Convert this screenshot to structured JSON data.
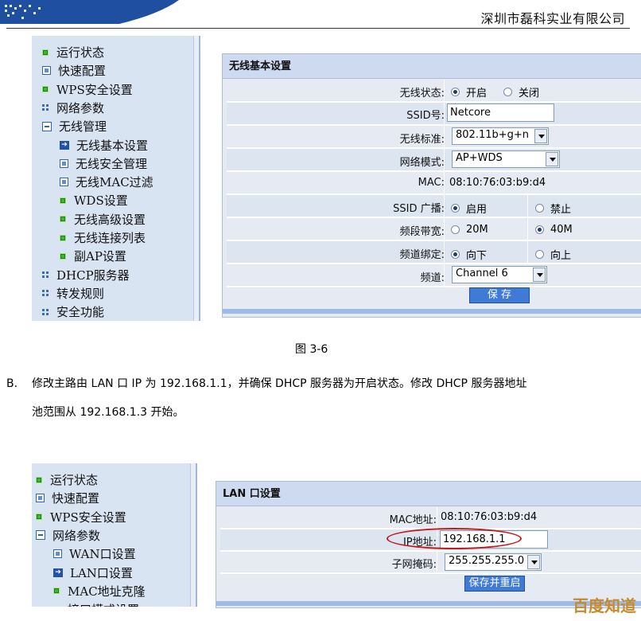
{
  "header": {
    "company": "深圳市磊科实业有限公司"
  },
  "figure1": {
    "caption": "图  3-6",
    "sidebar": {
      "items": [
        {
          "label": "运行状态",
          "icon": "bullet-green-icon",
          "indent": 0
        },
        {
          "label": "快速配置",
          "icon": "box-icon",
          "indent": 0
        },
        {
          "label": "WPS安全设置",
          "icon": "bullet-green-icon",
          "indent": 0
        },
        {
          "label": "网络参数",
          "icon": "grid-icon",
          "indent": 0
        },
        {
          "label": "无线管理",
          "icon": "minus-box-icon",
          "indent": 0
        },
        {
          "label": "无线基本设置",
          "icon": "arrow-right-icon",
          "indent": 1
        },
        {
          "label": "无线安全管理",
          "icon": "box-icon",
          "indent": 1
        },
        {
          "label": "无线MAC过滤",
          "icon": "box-icon",
          "indent": 1
        },
        {
          "label": "WDS设置",
          "icon": "bullet-green-icon",
          "indent": 1
        },
        {
          "label": "无线高级设置",
          "icon": "bullet-green-icon",
          "indent": 1
        },
        {
          "label": "无线连接列表",
          "icon": "bullet-green-icon",
          "indent": 1
        },
        {
          "label": "副AP设置",
          "icon": "bullet-green-icon",
          "indent": 1
        },
        {
          "label": "DHCP服务器",
          "icon": "grid-icon",
          "indent": 0
        },
        {
          "label": "转发规则",
          "icon": "grid-icon",
          "indent": 0
        },
        {
          "label": "安全功能",
          "icon": "grid-icon",
          "indent": 0
        }
      ]
    },
    "panel": {
      "title": "无线基本设置",
      "wireless_status": {
        "label": "无线状态:",
        "on": "开启",
        "off": "关闭",
        "selected": "开启"
      },
      "ssid": {
        "label": "SSID号:",
        "value": "Netcore"
      },
      "standard": {
        "label": "无线标准:",
        "value": "802.11b+g+n"
      },
      "mode": {
        "label": "网络模式:",
        "value": "AP+WDS"
      },
      "mac": {
        "label": "MAC:",
        "value": "08:10:76:03:b9:d4"
      },
      "ssid_broadcast": {
        "label": "SSID 广播:",
        "on": "启用",
        "off": "禁止",
        "selected": "启用"
      },
      "bandwidth": {
        "label": "频段带宽:",
        "a": "20M",
        "b": "40M",
        "selected": "40M"
      },
      "channel_bind": {
        "label": "频道绑定:",
        "down": "向下",
        "up": "向上",
        "selected": "向下"
      },
      "channel": {
        "label": "频道:",
        "value": "Channel 6"
      },
      "save_label": "保 存"
    }
  },
  "paragraph": {
    "marker": "B.",
    "line1": "修改主路由 LAN 口 IP 为 192.168.1.1，并确保 DHCP 服务器为开启状态。修改 DHCP 服务器地址",
    "line2": "池范围从 192.168.1.3 开始。"
  },
  "figure2": {
    "sidebar": {
      "items": [
        {
          "label": "运行状态",
          "icon": "bullet-green-icon",
          "indent": 0
        },
        {
          "label": "快速配置",
          "icon": "box-icon",
          "indent": 0
        },
        {
          "label": "WPS安全设置",
          "icon": "bullet-green-icon",
          "indent": 0
        },
        {
          "label": "网络参数",
          "icon": "minus-box-icon",
          "indent": 0
        },
        {
          "label": "WAN口设置",
          "icon": "box-icon",
          "indent": 1
        },
        {
          "label": "LAN口设置",
          "icon": "arrow-right-icon",
          "indent": 1
        },
        {
          "label": "MAC地址克隆",
          "icon": "bullet-green-icon",
          "indent": 1
        },
        {
          "label": "接口模式设置",
          "icon": "bullet-green-icon",
          "indent": 1
        }
      ]
    },
    "panel": {
      "title": "LAN 口设置",
      "mac": {
        "label": "MAC地址:",
        "value": "08:10:76:03:b9:d4"
      },
      "ip": {
        "label": "IP地址:",
        "value": "192.168.1.1"
      },
      "mask": {
        "label": "子网掩码:",
        "value": "255.255.255.0"
      },
      "save_label": "保存并重启"
    }
  },
  "watermark": "百度知道"
}
